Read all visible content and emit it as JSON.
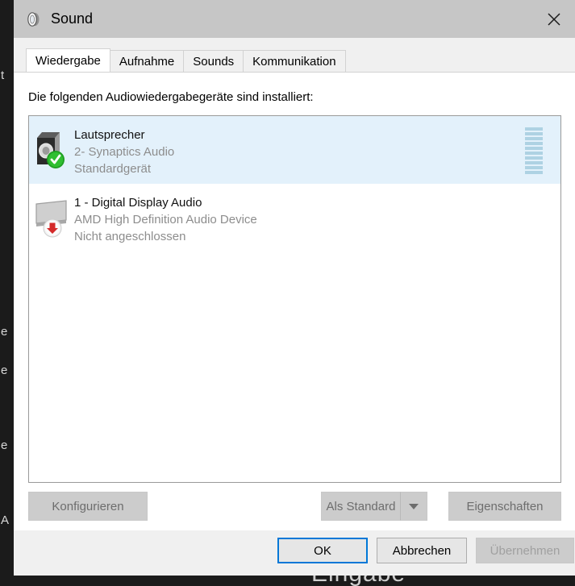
{
  "window": {
    "title": "Sound",
    "icon": "speaker-icon",
    "close_label": "✕"
  },
  "tabs": [
    {
      "label": "Wiedergabe",
      "active": true
    },
    {
      "label": "Aufnahme",
      "active": false
    },
    {
      "label": "Sounds",
      "active": false
    },
    {
      "label": "Kommunikation",
      "active": false
    }
  ],
  "panel": {
    "description": "Die folgenden Audiowiedergabegeräte sind installiert:"
  },
  "devices": [
    {
      "name": "Lautsprecher",
      "subtitle": "2- Synaptics Audio",
      "status": "Standardgerät",
      "icon": "speaker-device-icon",
      "badge": "green-check-badge",
      "selected": true,
      "meter_segments": 10
    },
    {
      "name": "1 - Digital Display Audio",
      "subtitle": "AMD High Definition Audio Device",
      "status": "Nicht angeschlossen",
      "icon": "monitor-device-icon",
      "badge": "red-down-arrow-badge",
      "selected": false,
      "meter_segments": 0
    }
  ],
  "buttons": {
    "configure": "Konfigurieren",
    "set_default": "Als Standard",
    "set_default_arrow": "chevron-down-icon",
    "properties": "Eigenschaften",
    "ok": "OK",
    "cancel": "Abbrechen",
    "apply": "Übernehmen"
  },
  "colors": {
    "selection": "#e3f1fb",
    "focus_border": "#0078d7",
    "titlebar": "#c6c6c6",
    "meter": "#aed2e3",
    "ok_badge_green": "#26a526",
    "badge_red": "#d42a2a"
  },
  "background": {
    "ghost_text": "Eingabe",
    "left_fragments": [
      "t",
      "e",
      "e",
      "e",
      "A"
    ]
  }
}
